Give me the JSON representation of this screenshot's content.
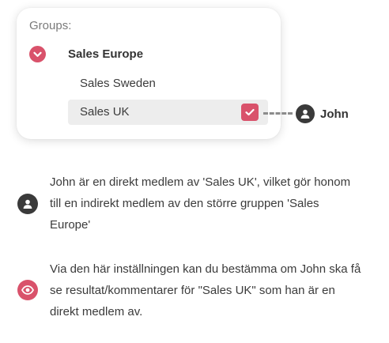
{
  "groups_panel": {
    "label": "Groups:",
    "parent_group": "Sales Europe",
    "child_groups": [
      {
        "label": "Sales Sweden",
        "checked": false
      },
      {
        "label": "Sales UK",
        "checked": true
      }
    ]
  },
  "member": {
    "name": "John"
  },
  "info": [
    {
      "icon": "user-icon",
      "text": "John är en direkt medlem av 'Sales UK', vilket gör honom till en indirekt medlem av den större gruppen 'Sales Europe'"
    },
    {
      "icon": "eye-icon",
      "text": "Via den här inställningen kan du bestämma om John ska få se resultat/kommentarer för \"Sales UK\" som han är en direkt medlem av."
    }
  ],
  "colors": {
    "accent": "#d9526b",
    "dark": "#3a3a3a",
    "row_highlight": "#ededed"
  }
}
